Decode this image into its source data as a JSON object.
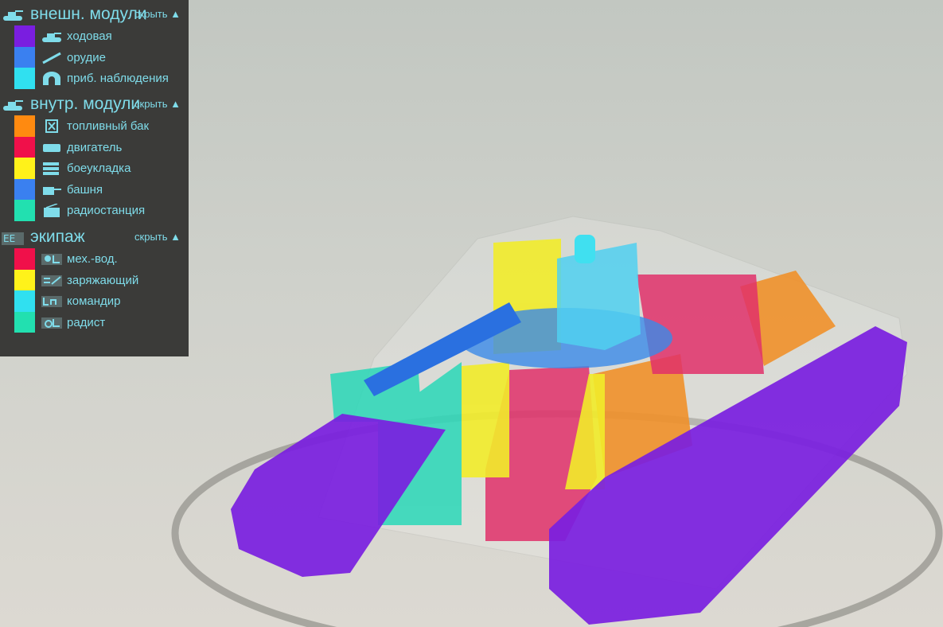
{
  "legend": {
    "hide_label": "скрыть ▲",
    "sections": [
      {
        "title": "внешн. модули",
        "icon": "tank-icon",
        "items": [
          {
            "label": "ходовая",
            "color": "#7a1ee0",
            "icon": "chassis-icon"
          },
          {
            "label": "орудие",
            "color": "#3a80f0",
            "icon": "gun-icon"
          },
          {
            "label": "приб. наблюдения",
            "color": "#30e0f0",
            "icon": "binoculars-icon"
          }
        ]
      },
      {
        "title": "внутр. модули",
        "icon": "tank-icon",
        "items": [
          {
            "label": "топливный бак",
            "color": "#ff8a10",
            "icon": "fuel-tank-icon"
          },
          {
            "label": "двигатель",
            "color": "#f0104a",
            "icon": "engine-icon"
          },
          {
            "label": "боеукладка",
            "color": "#fff21a",
            "icon": "ammo-rack-icon"
          },
          {
            "label": "башня",
            "color": "#3a80f0",
            "icon": "turret-icon"
          },
          {
            "label": "радиостанция",
            "color": "#22e0b0",
            "icon": "radio-icon"
          }
        ]
      },
      {
        "title": "экипаж",
        "icon": "crew-icon",
        "items": [
          {
            "label": "мех.-вод.",
            "color": "#f0104a",
            "icon": "driver-icon"
          },
          {
            "label": "заряжающий",
            "color": "#fff21a",
            "icon": "loader-icon"
          },
          {
            "label": "командир",
            "color": "#30e0f0",
            "icon": "commander-icon"
          },
          {
            "label": "радист",
            "color": "#22e0b0",
            "icon": "radio-operator-icon"
          }
        ]
      }
    ]
  }
}
